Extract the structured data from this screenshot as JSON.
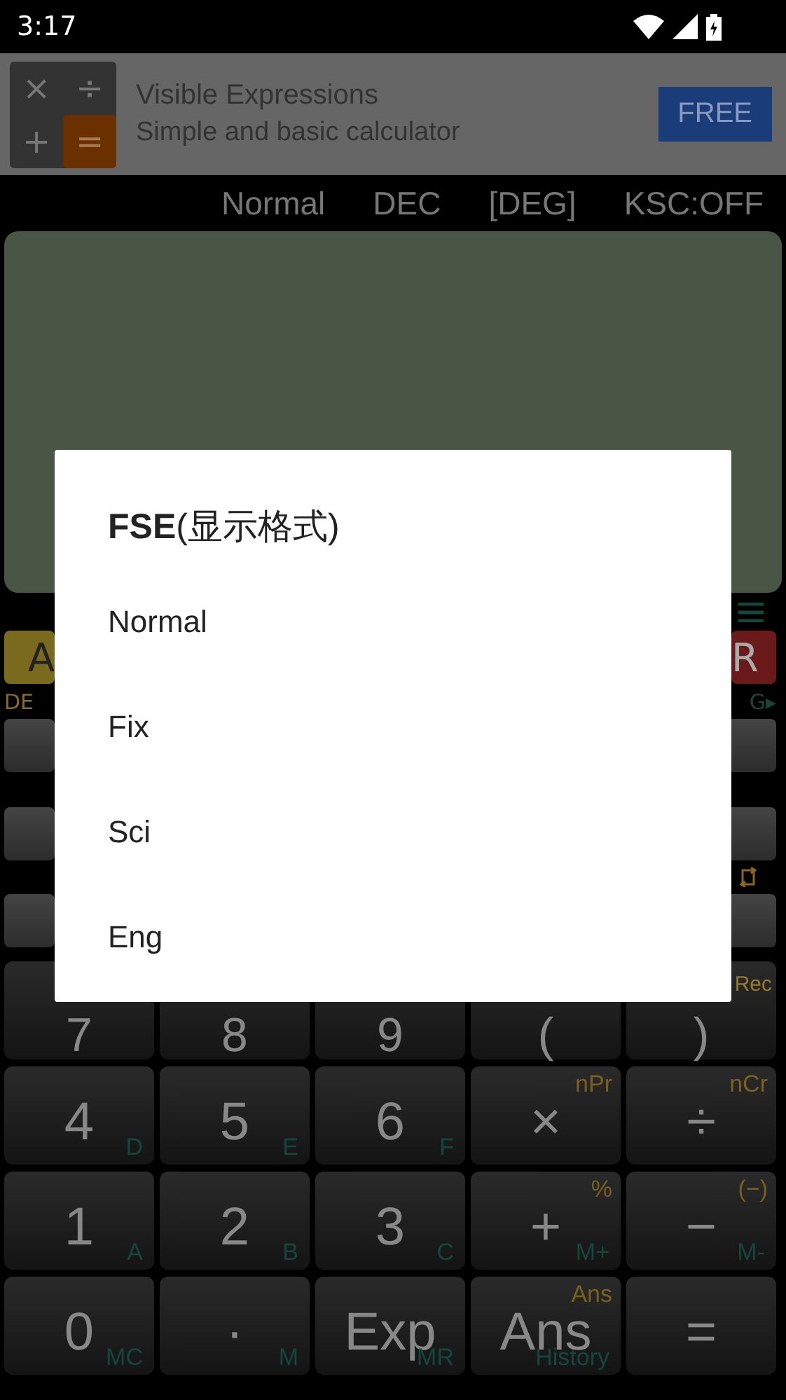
{
  "status_bar": {
    "time": "3:17"
  },
  "ad": {
    "keys": [
      "×",
      "÷",
      "+",
      "="
    ],
    "title": "Visible Expressions",
    "subtitle": "Simple and basic calculator",
    "button": "FREE"
  },
  "indicators": [
    "Normal",
    "DEC",
    "[DEG]",
    "KSC:OFF"
  ],
  "hidden_row": {
    "left_key": "A",
    "right_key": "R",
    "left_label": "DE",
    "right_label": "G▸"
  },
  "keypad": [
    {
      "main": "7"
    },
    {
      "main": "8"
    },
    {
      "main": "9"
    },
    {
      "main": "("
    },
    {
      "main": ")",
      "top": "Rec"
    },
    {
      "main": "4",
      "bottom": "D"
    },
    {
      "main": "5",
      "bottom": "E"
    },
    {
      "main": "6",
      "bottom": "F"
    },
    {
      "main": "×",
      "top": "nPr"
    },
    {
      "main": "÷",
      "top": "nCr"
    },
    {
      "main": "1",
      "bottom": "A"
    },
    {
      "main": "2",
      "bottom": "B"
    },
    {
      "main": "3",
      "bottom": "C"
    },
    {
      "main": "+",
      "top": "%",
      "bottom": "M+"
    },
    {
      "main": "−",
      "top": "(−)",
      "bottom": "M-"
    },
    {
      "main": "0",
      "bottom": "MC"
    },
    {
      "main": "·",
      "bottom": "M"
    },
    {
      "main": "Exp",
      "bottom": "MR"
    },
    {
      "main": "Ans",
      "top": "Ans",
      "bottom": "History"
    },
    {
      "main": "="
    }
  ],
  "dialog": {
    "title": "**FSE**(显示格式)",
    "options": [
      "Normal",
      "Fix",
      "Sci",
      "Eng"
    ]
  }
}
